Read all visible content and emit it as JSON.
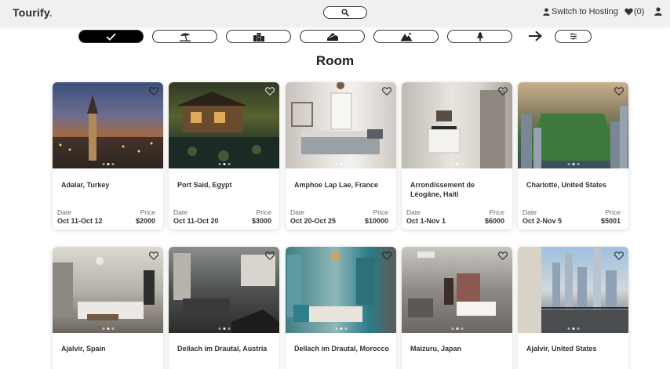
{
  "brand": {
    "name": "Tourify",
    "dot": ".",
    "accent": "#1ea7c8"
  },
  "header": {
    "host_label": "Switch to Hosting",
    "favorites_label": "(0)"
  },
  "categories": [
    {
      "icon": "check-icon",
      "active": true
    },
    {
      "icon": "beach-icon",
      "active": false
    },
    {
      "icon": "city-icon",
      "active": false
    },
    {
      "icon": "cabin-icon",
      "active": false
    },
    {
      "icon": "mountain-icon",
      "active": false
    },
    {
      "icon": "forest-icon",
      "active": false
    }
  ],
  "section_title": "Room",
  "card_labels": {
    "date": "Date",
    "price": "Price"
  },
  "listings": [
    {
      "location": "Adalar, Turkey",
      "date": "Oct 11-Oct 12",
      "price": "$2000"
    },
    {
      "location": "Port Said, Egypt",
      "date": "Oct 11-Oct 20",
      "price": "$3000"
    },
    {
      "location": "Amphoe Lap Lae, France",
      "date": "Oct 20-Oct 25",
      "price": "$10000"
    },
    {
      "location": "Arrondissement de Léogâne, Haiti",
      "date": "Oct 1-Nov 1",
      "price": "$6000"
    },
    {
      "location": "Charlotte, United States",
      "date": "Oct 2-Nov 5",
      "price": "$5001"
    },
    {
      "location": "Ajalvir, Spain"
    },
    {
      "location": "Dellach im Drautal, Austria"
    },
    {
      "location": "Dellach im Drautal, Morocco"
    },
    {
      "location": "Maizuru, Japan"
    },
    {
      "location": "Ajalvir, United States"
    }
  ]
}
